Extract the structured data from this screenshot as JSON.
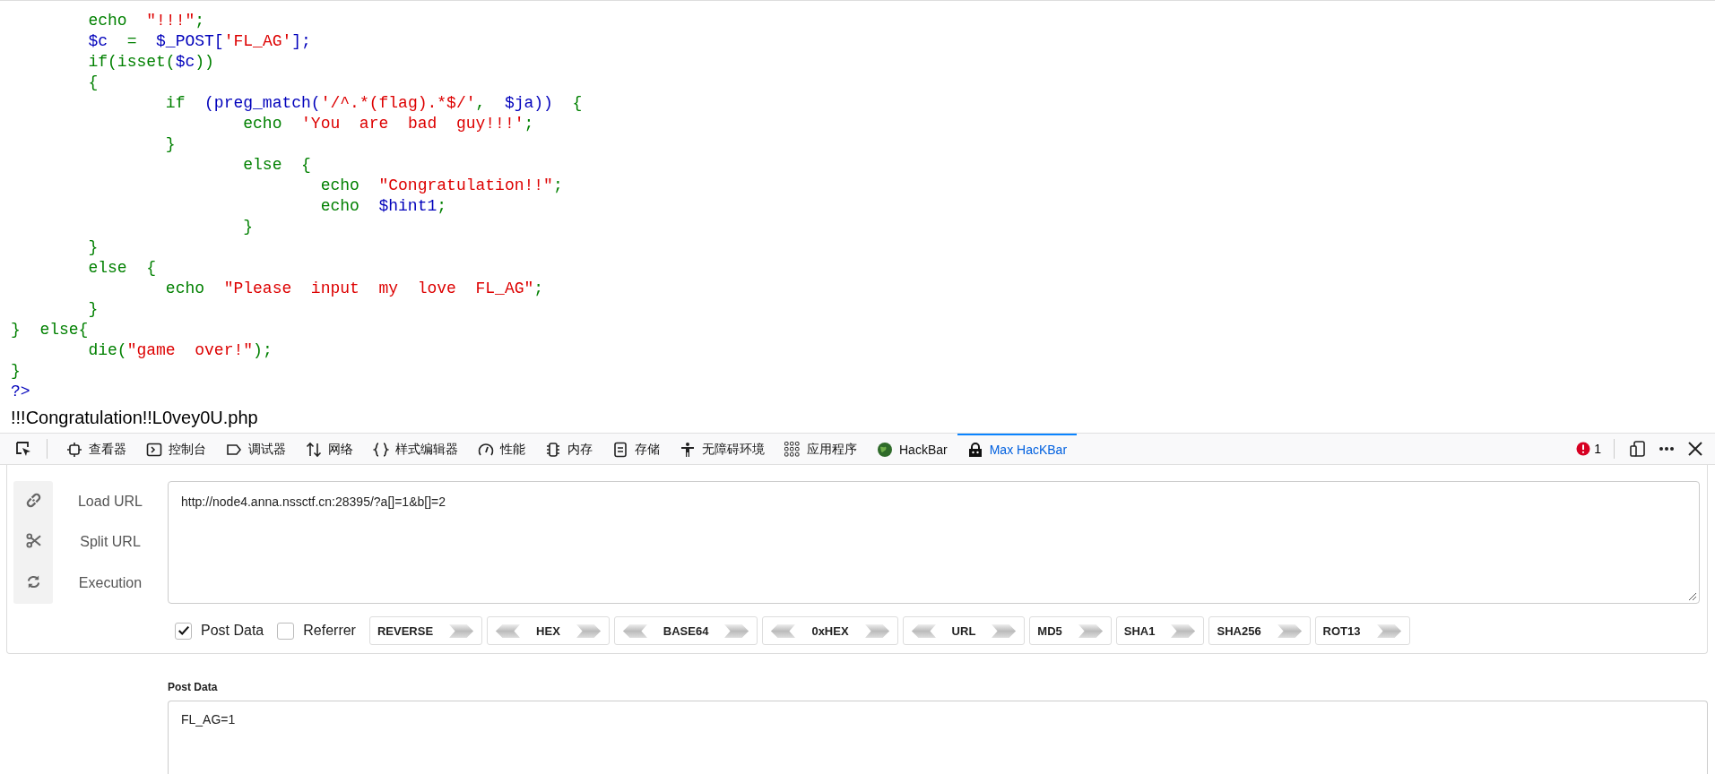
{
  "code": {
    "lines": [
      [
        {
          "kind": "keyword",
          "text": "\techo  "
        },
        {
          "kind": "string",
          "text": "\"!!!\""
        },
        {
          "kind": "keyword",
          "text": ";"
        }
      ],
      [
        {
          "kind": "default",
          "text": "\t$c"
        },
        {
          "kind": "keyword",
          "text": "  =  "
        },
        {
          "kind": "default",
          "text": "$_POST["
        },
        {
          "kind": "string",
          "text": "'FL_AG'"
        },
        {
          "kind": "default",
          "text": "];"
        }
      ],
      [
        {
          "kind": "keyword",
          "text": "\tif(isset("
        },
        {
          "kind": "default",
          "text": "$c"
        },
        {
          "kind": "keyword",
          "text": "))"
        }
      ],
      [
        {
          "kind": "keyword",
          "text": "\t{"
        }
      ],
      [
        {
          "kind": "keyword",
          "text": "\t\tif  "
        },
        {
          "kind": "default",
          "text": "(preg_match("
        },
        {
          "kind": "string",
          "text": "'/^.*(flag).*$/'"
        },
        {
          "kind": "keyword",
          "text": ",  "
        },
        {
          "kind": "default",
          "text": "$ja))"
        },
        {
          "kind": "keyword",
          "text": "  {"
        }
      ],
      [
        {
          "kind": "keyword",
          "text": "\t\t\techo  "
        },
        {
          "kind": "string",
          "text": "'You  are  bad  guy!!!'"
        },
        {
          "kind": "keyword",
          "text": ";"
        }
      ],
      [
        {
          "kind": "keyword",
          "text": "\t\t}"
        }
      ],
      [
        {
          "kind": "keyword",
          "text": "\t\t\telse  {"
        }
      ],
      [
        {
          "kind": "keyword",
          "text": "\t\t\t\techo  "
        },
        {
          "kind": "string",
          "text": "\"Congratulation!!\""
        },
        {
          "kind": "keyword",
          "text": ";"
        }
      ],
      [
        {
          "kind": "keyword",
          "text": "\t\t\t\techo  "
        },
        {
          "kind": "default",
          "text": "$hint1"
        },
        {
          "kind": "keyword",
          "text": ";"
        }
      ],
      [
        {
          "kind": "keyword",
          "text": "\t\t\t}"
        }
      ],
      [
        {
          "kind": "keyword",
          "text": "\t}"
        }
      ],
      [
        {
          "kind": "keyword",
          "text": "\telse  {"
        }
      ],
      [
        {
          "kind": "keyword",
          "text": "\t\techo  "
        },
        {
          "kind": "string",
          "text": "\"Please  input  my  love  FL_AG\""
        },
        {
          "kind": "keyword",
          "text": ";"
        }
      ],
      [
        {
          "kind": "keyword",
          "text": "\t}"
        }
      ],
      [
        {
          "kind": "keyword",
          "text": "}  else{"
        }
      ],
      [
        {
          "kind": "keyword",
          "text": "\tdie("
        },
        {
          "kind": "string",
          "text": "\"game  over!\""
        },
        {
          "kind": "keyword",
          "text": ");"
        }
      ],
      [
        {
          "kind": "keyword",
          "text": "}"
        }
      ],
      [
        {
          "kind": "default",
          "text": "?>"
        }
      ]
    ],
    "output": "!!!Congratulation!!L0vey0U.php"
  },
  "devtools": {
    "tabs": [
      {
        "label": "查看器",
        "selected": false
      },
      {
        "label": "控制台",
        "selected": false
      },
      {
        "label": "调试器",
        "selected": false
      },
      {
        "label": "网络",
        "selected": false
      },
      {
        "label": "样式编辑器",
        "selected": false
      },
      {
        "label": "性能",
        "selected": false
      },
      {
        "label": "内存",
        "selected": false
      },
      {
        "label": "存储",
        "selected": false
      },
      {
        "label": "无障碍环境",
        "selected": false
      },
      {
        "label": "应用程序",
        "selected": false
      },
      {
        "label": "HackBar",
        "selected": false
      },
      {
        "label": "Max HacKBar",
        "selected": true
      }
    ],
    "error_count": "1"
  },
  "hackbar": {
    "actions": [
      "Load URL",
      "Split URL",
      "Execution"
    ],
    "url": "http://node4.anna.nssctf.cn:28395/?a[]=1&b[]=2",
    "options": [
      {
        "label": "Post Data",
        "checked": true
      },
      {
        "label": "Referrer",
        "checked": false
      }
    ],
    "buttons": [
      {
        "label": "REVERSE",
        "left_arrow": false
      },
      {
        "label": "HEX",
        "left_arrow": true
      },
      {
        "label": "BASE64",
        "left_arrow": true
      },
      {
        "label": "0xHEX",
        "left_arrow": true
      },
      {
        "label": "URL",
        "left_arrow": true
      },
      {
        "label": "MD5",
        "left_arrow": false
      },
      {
        "label": "SHA1",
        "left_arrow": false
      },
      {
        "label": "SHA256",
        "left_arrow": false
      },
      {
        "label": "ROT13",
        "left_arrow": false
      }
    ],
    "post_data_title": "Post Data",
    "post_data": "FL_AG=1"
  }
}
